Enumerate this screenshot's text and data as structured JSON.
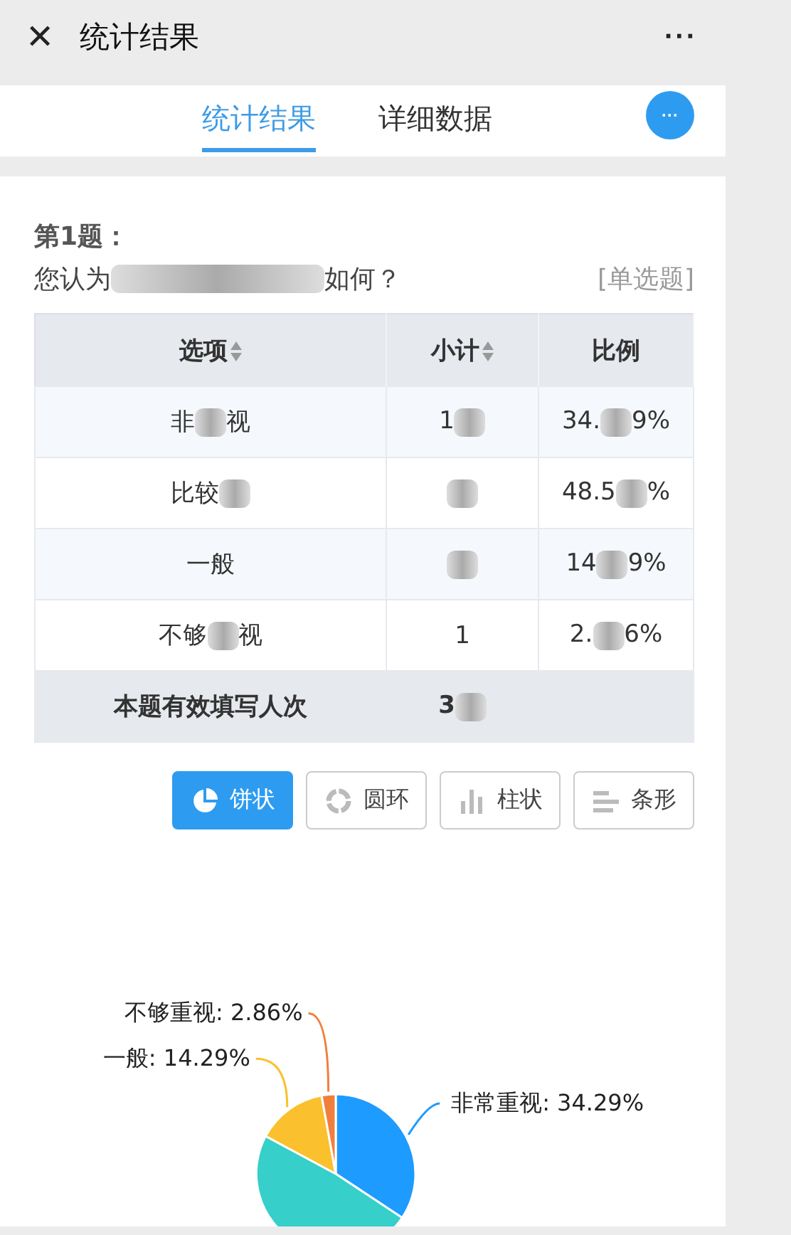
{
  "top_bar": {
    "close": "✕",
    "title": "统计结果",
    "more": "···"
  },
  "tabs": [
    {
      "label": "统计结果",
      "selected": true
    },
    {
      "label": "详细数据",
      "selected": false
    }
  ],
  "fab": "···",
  "question": {
    "number": "第1题：",
    "text": [
      {
        "text": "您认为"
      },
      {
        "kind": "blur"
      },
      {
        "text": "如何？"
      }
    ],
    "type": "[单选题]"
  },
  "table": {
    "columns": [
      {
        "label": "选项",
        "sortable": true
      },
      {
        "label": "小计",
        "sortable": true
      },
      {
        "label": "比例",
        "sortable": false
      }
    ],
    "rows": [
      {
        "option": [
          {
            "text": "非"
          },
          {
            "kind": "blur"
          },
          {
            "text": "视"
          }
        ],
        "count": [
          {
            "text": "1"
          },
          {
            "kind": "blur"
          }
        ],
        "percent": [
          {
            "text": "34."
          },
          {
            "kind": "blur"
          },
          {
            "text": "9%"
          }
        ]
      },
      {
        "option": [
          {
            "text": "比较"
          },
          {
            "kind": "blur"
          }
        ],
        "count": [
          {
            "kind": "blur"
          }
        ],
        "percent": [
          {
            "text": "48.5"
          },
          {
            "kind": "blur"
          },
          {
            "text": "%"
          }
        ]
      },
      {
        "option": [
          {
            "text": "一般"
          }
        ],
        "count": [
          {
            "kind": "blur"
          }
        ],
        "percent": [
          {
            "text": "14"
          },
          {
            "kind": "blur"
          },
          {
            "text": "9%"
          }
        ]
      },
      {
        "option": [
          {
            "text": "不够"
          },
          {
            "kind": "blur"
          },
          {
            "text": "视"
          }
        ],
        "count": [
          {
            "text": "1"
          }
        ],
        "percent": [
          {
            "text": "2."
          },
          {
            "kind": "blur"
          },
          {
            "text": "6%"
          }
        ]
      }
    ],
    "total": {
      "label": "本题有效填写人次",
      "count": [
        {
          "text": "3"
        },
        {
          "kind": "blur"
        }
      ]
    }
  },
  "chart_types": [
    {
      "label": "饼状",
      "kind": "pie",
      "selected": true
    },
    {
      "label": "圆环",
      "kind": "ring",
      "selected": false
    },
    {
      "label": "柱状",
      "kind": "column",
      "selected": false
    },
    {
      "label": "条形",
      "kind": "bar",
      "selected": false
    }
  ],
  "chart_data": {
    "type": "pie",
    "values": [
      34.29,
      48.57,
      14.29,
      2.86
    ],
    "annotations": [
      {
        "text": "非常重视: 34.29%"
      },
      {
        "text": "一般: 14.29%"
      },
      {
        "text": "不够重视: 2.86%"
      }
    ]
  }
}
